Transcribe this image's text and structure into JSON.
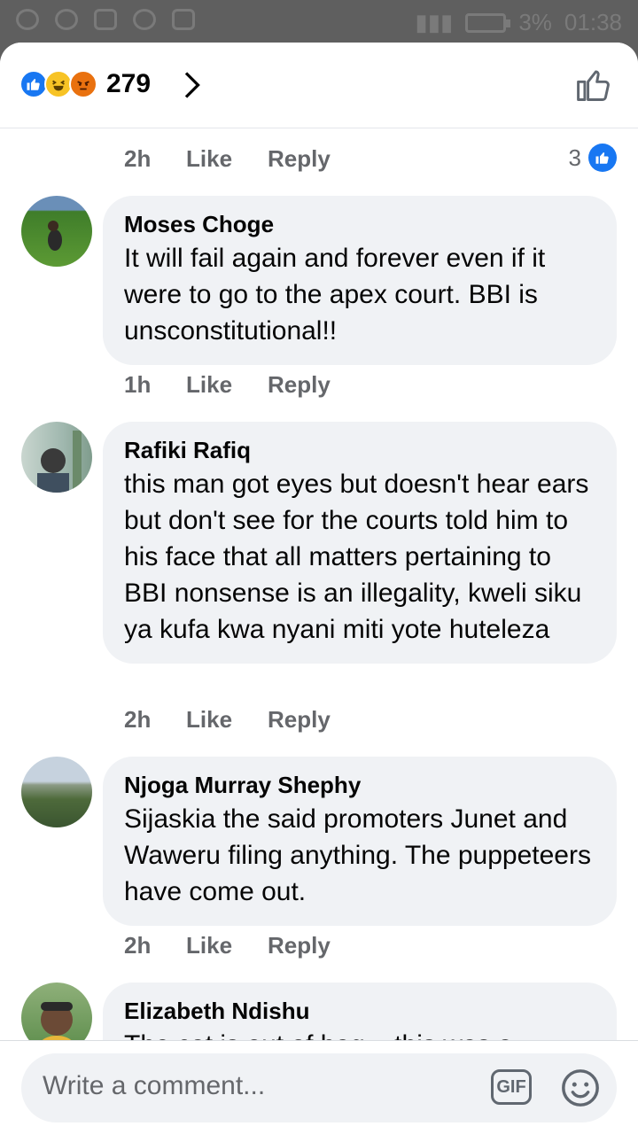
{
  "status_bar": {
    "battery": "3%",
    "time": "01:38"
  },
  "header": {
    "reaction_icons": [
      "like-icon",
      "haha-icon",
      "angry-icon"
    ],
    "reaction_count": "279"
  },
  "top_partial": {
    "time": "2h",
    "like_label": "Like",
    "reply_label": "Reply",
    "like_count": "3"
  },
  "comments": [
    {
      "author": "Moses Choge",
      "text": "It will fail again and forever even if it were to go to the apex court. BBI is unsconstitutional!!",
      "time": "1h",
      "like_label": "Like",
      "reply_label": "Reply"
    },
    {
      "author": "Rafiki Rafiq",
      "text": "this man got eyes but doesn't hear ears but don't see for the courts told him to his face that all matters pertaining to BBI nonsense is an illegality, kweli siku ya kufa kwa nyani miti yote huteleza",
      "time": "2h",
      "like_label": "Like",
      "reply_label": "Reply"
    },
    {
      "author": "Njoga Murray Shephy",
      "text": "Sijaskia the said promoters Junet and Waweru filing anything. The puppeteers have come out.",
      "time": "2h",
      "like_label": "Like",
      "reply_label": "Reply"
    },
    {
      "author": "Elizabeth Ndishu",
      "text": "The cat is out of bag... this was a"
    }
  ],
  "footer": {
    "placeholder": "Write a comment...",
    "gif_label": "GIF"
  },
  "colors": {
    "accent": "#1877f2",
    "bubble": "#f0f2f5",
    "muted_text": "#65676b"
  }
}
